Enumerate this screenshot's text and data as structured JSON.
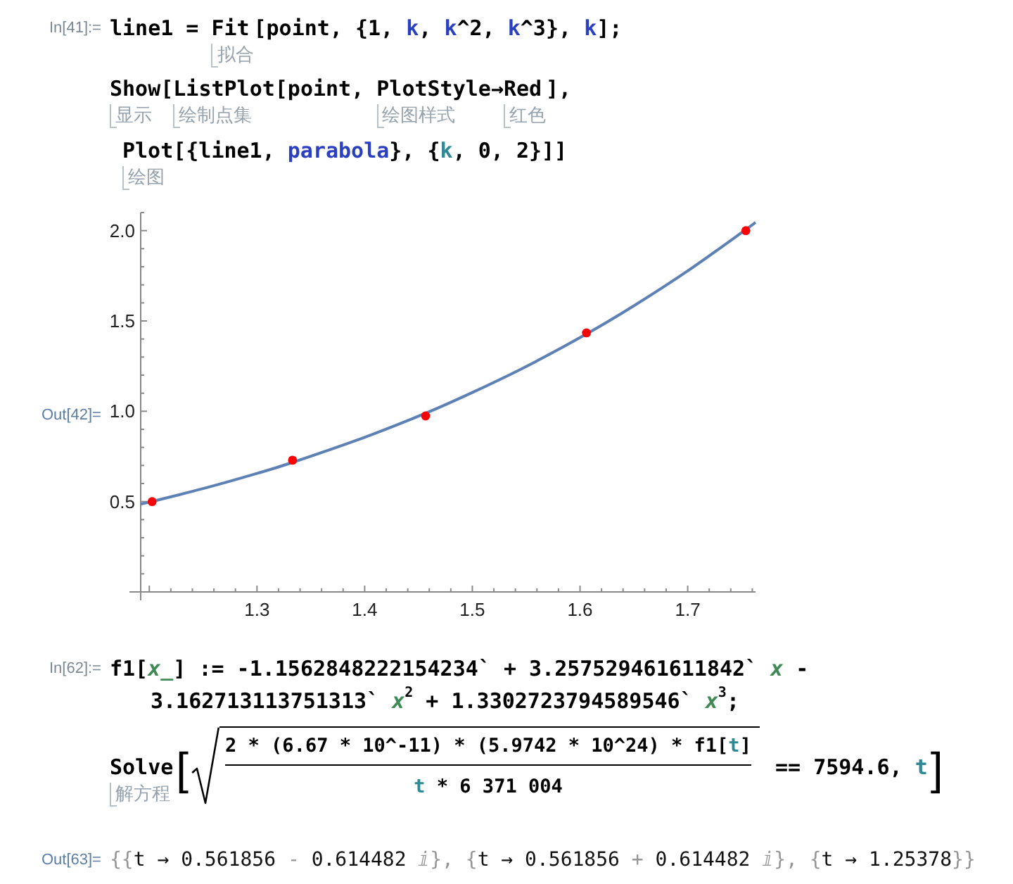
{
  "cells": [
    {
      "kind": "input",
      "label": "In[41]:=",
      "lines": [
        {
          "kind": "start",
          "tokens": [
            {
              "text": "line1 = ",
              "kind": "plain"
            },
            {
              "text": "Fit",
              "kind": "plain",
              "hint": "拟合"
            },
            {
              "text": "[point, {1, ",
              "kind": "plain"
            },
            {
              "text": "k",
              "kind": "global"
            },
            {
              "text": ", ",
              "kind": "plain"
            },
            {
              "text": "k",
              "kind": "global"
            },
            {
              "text": "^2, ",
              "kind": "plain"
            },
            {
              "text": "k",
              "kind": "global"
            },
            {
              "text": "^3}, ",
              "kind": "plain"
            },
            {
              "text": "k",
              "kind": "global"
            },
            {
              "text": "];",
              "kind": "plain"
            }
          ]
        },
        {
          "kind": "start",
          "tokens": [
            {
              "text": "Show",
              "kind": "plain",
              "hint": "显示"
            },
            {
              "text": "[",
              "kind": "plain"
            },
            {
              "text": "ListPlot",
              "kind": "plain",
              "hint": "绘制点集"
            },
            {
              "text": "[point, ",
              "kind": "plain"
            },
            {
              "text": "PlotStyle",
              "kind": "plain",
              "hint": "绘图样式"
            },
            {
              "text": "→",
              "kind": "plain"
            },
            {
              "text": "Red",
              "kind": "plain",
              "hint": "红色"
            },
            {
              "text": "],",
              "kind": "plain"
            }
          ]
        },
        {
          "kind": "inner",
          "tokens": [
            {
              "text": "Plot",
              "kind": "plain",
              "hint": "绘图"
            },
            {
              "text": "[{line1, ",
              "kind": "plain"
            },
            {
              "text": "parabola",
              "kind": "global"
            },
            {
              "text": "}, {",
              "kind": "plain"
            },
            {
              "text": "k",
              "kind": "local"
            },
            {
              "text": ", 0, 2}]]",
              "kind": "plain"
            }
          ]
        }
      ]
    },
    {
      "kind": "plot",
      "label": "Out[42]=",
      "chart_data": {
        "type": "line",
        "x": [
          1.192,
          1.2026,
          1.25,
          1.3,
          1.333,
          1.4,
          1.4566,
          1.5,
          1.55,
          1.606,
          1.65,
          1.7,
          1.754,
          1.763
        ],
        "series": [
          {
            "color": "#5e81b5",
            "values": [
              0.486,
              0.501,
              0.572,
              0.656,
              0.717,
              0.856,
              0.989,
              1.104,
              1.248,
              1.428,
              1.584,
              1.777,
              2.006,
              2.046
            ]
          },
          {
            "type": "scatter",
            "color": "#ff0000",
            "values": [
              null,
              0.5,
              null,
              null,
              0.729,
              null,
              0.974,
              null,
              null,
              1.434,
              null,
              null,
              2.0,
              null
            ]
          }
        ],
        "xlim": [
          1.192,
          1.763
        ],
        "ylim": [
          0,
          2.1
        ],
        "xticks": [
          1.3,
          1.4,
          1.5,
          1.6,
          1.7
        ],
        "yticks": [
          0.5,
          {
            "value": 1,
            "label": "1.0"
          },
          1.5,
          {
            "value": 2,
            "label": "2.0"
          }
        ]
      }
    },
    {
      "kind": "input",
      "label": "In[62]:=",
      "lines": [
        {
          "kind": "start",
          "tokens": [
            {
              "text": "f1[",
              "kind": "plain"
            },
            {
              "text": "x_",
              "kind": "pattern"
            },
            {
              "text": "] := -1.1562848222154234` + 3.257529461611842` ",
              "kind": "plain"
            },
            {
              "text": "x",
              "kind": "pattern"
            },
            {
              "text": " -",
              "kind": "plain"
            }
          ]
        },
        {
          "kind": "wrap",
          "tokens": [
            {
              "text": "3.162713113751313` ",
              "kind": "plain"
            },
            {
              "text": "x",
              "kind": "pattern"
            },
            {
              "text": "2",
              "kind": "sup"
            },
            {
              "text": " + 1.3302723794589546` ",
              "kind": "plain"
            },
            {
              "text": "x",
              "kind": "pattern"
            },
            {
              "text": "3",
              "kind": "sup"
            },
            {
              "text": ";",
              "kind": "plain"
            }
          ]
        },
        {
          "kind": "display",
          "tokens": [
            {
              "text": "Solve",
              "kind": "plain",
              "hint": "解方程"
            },
            {
              "text": "[",
              "kind": "bigbracket"
            },
            {
              "kind": "sqrtfrac",
              "numerator": [
                {
                  "text": "2 * (6.67 * 10^-11) * (5.9742 * 10^24) * f1[",
                  "kind": "plain"
                },
                {
                  "text": "t",
                  "kind": "local"
                },
                {
                  "text": "]",
                  "kind": "plain"
                }
              ],
              "denominator": [
                {
                  "text": "t",
                  "kind": "local"
                },
                {
                  "text": " * 6 371 004",
                  "kind": "plain"
                }
              ]
            },
            {
              "text": " == 7594.6, ",
              "kind": "plain"
            },
            {
              "text": "t",
              "kind": "local"
            },
            {
              "text": "]",
              "kind": "bigbracket"
            }
          ]
        }
      ]
    },
    {
      "kind": "output",
      "label": "Out[63]=",
      "lines": [
        {
          "kind": "start",
          "tokens": [
            {
              "text": "{{",
              "kind": "muted"
            },
            {
              "text": "t → 0.561856",
              "kind": "plain"
            },
            {
              "text": " - ",
              "kind": "muted"
            },
            {
              "text": "0.614482",
              "kind": "plain"
            },
            {
              "text": " ⅈ",
              "kind": "muted"
            },
            {
              "text": "}, {",
              "kind": "muted"
            },
            {
              "text": "t → 0.561856",
              "kind": "plain"
            },
            {
              "text": " + ",
              "kind": "muted"
            },
            {
              "text": "0.614482",
              "kind": "plain"
            },
            {
              "text": " ⅈ",
              "kind": "muted"
            },
            {
              "text": "}, {",
              "kind": "muted"
            },
            {
              "text": "t → 1.25378",
              "kind": "plain"
            },
            {
              "text": "}}",
              "kind": "muted"
            }
          ]
        }
      ]
    }
  ]
}
